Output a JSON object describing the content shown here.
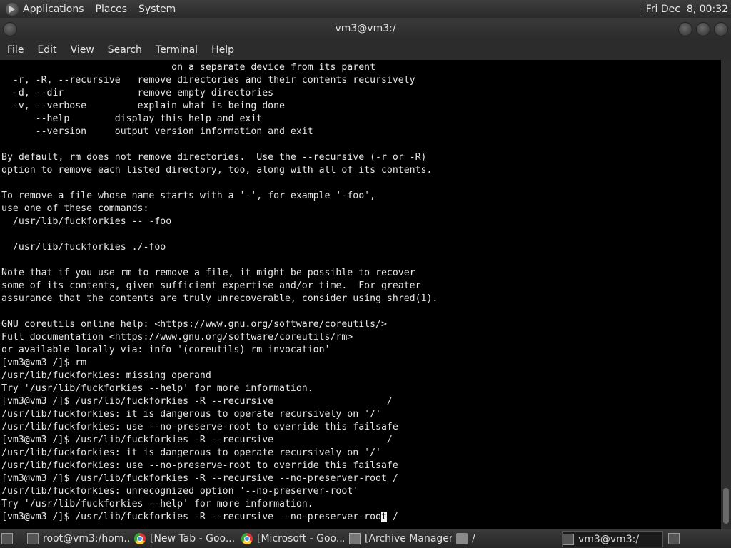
{
  "top_panel": {
    "menus": [
      "Applications",
      "Places",
      "System"
    ],
    "clock": "Fri Dec  8, 00:32"
  },
  "window": {
    "title": "vm3@vm3:/",
    "menu": [
      "File",
      "Edit",
      "View",
      "Search",
      "Terminal",
      "Help"
    ]
  },
  "terminal": {
    "lines": [
      "                              on a separate device from its parent",
      "  -r, -R, --recursive   remove directories and their contents recursively",
      "  -d, --dir             remove empty directories",
      "  -v, --verbose         explain what is being done",
      "      --help        display this help and exit",
      "      --version     output version information and exit",
      "",
      "By default, rm does not remove directories.  Use the --recursive (-r or -R)",
      "option to remove each listed directory, too, along with all of its contents.",
      "",
      "To remove a file whose name starts with a '-', for example '-foo',",
      "use one of these commands:",
      "  /usr/lib/fuckforkies -- -foo",
      "",
      "  /usr/lib/fuckforkies ./-foo",
      "",
      "Note that if you use rm to remove a file, it might be possible to recover",
      "some of its contents, given sufficient expertise and/or time.  For greater",
      "assurance that the contents are truly unrecoverable, consider using shred(1).",
      "",
      "GNU coreutils online help: <https://www.gnu.org/software/coreutils/>",
      "Full documentation <https://www.gnu.org/software/coreutils/rm>",
      "or available locally via: info '(coreutils) rm invocation'",
      "[vm3@vm3 /]$ rm",
      "/usr/lib/fuckforkies: missing operand",
      "Try '/usr/lib/fuckforkies --help' for more information.",
      "[vm3@vm3 /]$ /usr/lib/fuckforkies -R --recursive                    /",
      "/usr/lib/fuckforkies: it is dangerous to operate recursively on '/'",
      "/usr/lib/fuckforkies: use --no-preserve-root to override this failsafe",
      "[vm3@vm3 /]$ /usr/lib/fuckforkies -R --recursive                    /",
      "/usr/lib/fuckforkies: it is dangerous to operate recursively on '/'",
      "/usr/lib/fuckforkies: use --no-preserve-root to override this failsafe",
      "[vm3@vm3 /]$ /usr/lib/fuckforkies -R --recursive --no-preserver-root /",
      "/usr/lib/fuckforkies: unrecognized option '--no-preserver-root'",
      "Try '/usr/lib/fuckforkies --help' for more information."
    ],
    "prompt_before_cursor": "[vm3@vm3 /]$ /usr/lib/fuckforkies -R --recursive --no-preserver-roo",
    "cursor_char": "t",
    "prompt_after_cursor": " /"
  },
  "taskbar": {
    "items": [
      {
        "label": "root@vm3:/hom...",
        "icon": "terminal-icon"
      },
      {
        "label": "[New Tab - Goo...",
        "icon": "chrome-icon"
      },
      {
        "label": "[Microsoft - Goo...",
        "icon": "chrome-icon"
      },
      {
        "label": "[Archive Manager]",
        "icon": "archive-icon"
      },
      {
        "label": "/",
        "icon": "folder-icon"
      },
      {
        "label": "vm3@vm3:/",
        "icon": "terminal-icon"
      }
    ]
  }
}
